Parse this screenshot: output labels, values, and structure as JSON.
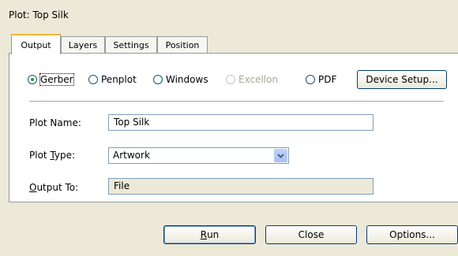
{
  "window": {
    "title": "Plot: Top Silk"
  },
  "tabs": [
    {
      "label": "Output"
    },
    {
      "label": "Layers"
    },
    {
      "label": "Settings"
    },
    {
      "label": "Position"
    }
  ],
  "output_format": {
    "options": [
      {
        "label": "Gerber",
        "selected": true,
        "enabled": true
      },
      {
        "label": "Penplot",
        "selected": false,
        "enabled": true
      },
      {
        "label": "Windows",
        "selected": false,
        "enabled": true
      },
      {
        "label": "Excellon",
        "selected": false,
        "enabled": false
      },
      {
        "label": "PDF",
        "selected": false,
        "enabled": true
      }
    ],
    "device_setup_label": "Device Setup..."
  },
  "fields": {
    "plot_name": {
      "label": "Plot Name:",
      "value": "Top Silk"
    },
    "plot_type": {
      "label_pre": "Plot ",
      "label_key": "T",
      "label_post": "ype:",
      "value": "Artwork"
    },
    "output_to": {
      "label_key": "O",
      "label_post": "utput To:",
      "value": "File"
    }
  },
  "buttons": {
    "run": {
      "key": "R",
      "rest": "un"
    },
    "close": "Close",
    "options": "Options..."
  },
  "colors": {
    "accent": "#f0b437",
    "radio_dot": "#21a121",
    "border": "#919b9c"
  }
}
